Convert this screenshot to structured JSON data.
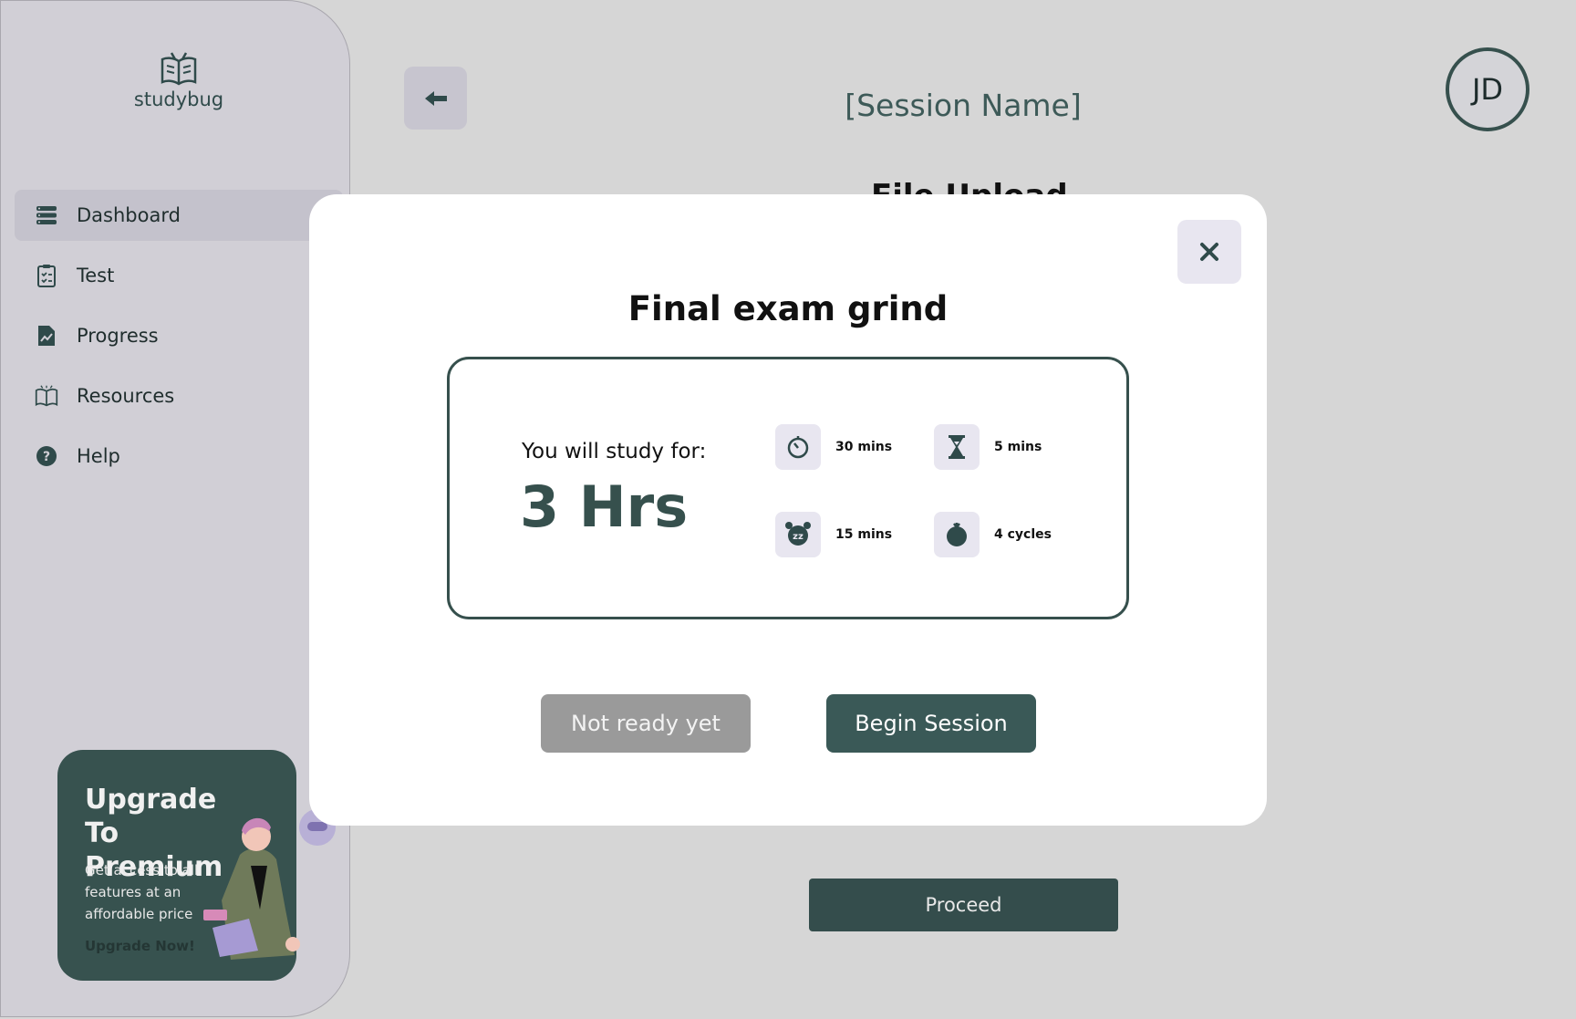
{
  "app": {
    "logo_text": "studybug"
  },
  "sidebar": {
    "items": [
      {
        "label": "Dashboard",
        "icon": "dashboard-icon",
        "active": true
      },
      {
        "label": "Test",
        "icon": "clipboard-icon"
      },
      {
        "label": "Progress",
        "icon": "progress-chart-icon"
      },
      {
        "label": "Resources",
        "icon": "book-icon"
      },
      {
        "label": "Help",
        "icon": "help-icon"
      }
    ]
  },
  "promo": {
    "title": "Upgrade To Premium",
    "description": "Get access to all features at an affordable price",
    "link": "Upgrade Now!"
  },
  "header": {
    "session_name": "[Session Name]",
    "avatar_initials": "JD",
    "behind_heading": "File Upload"
  },
  "main": {
    "proceed_label": "Proceed"
  },
  "modal": {
    "title": "Final exam grind",
    "study_label": "You will study for:",
    "study_value": "3 Hrs",
    "stats": [
      {
        "icon": "stopwatch-icon",
        "label": "30 mins"
      },
      {
        "icon": "hourglass-icon",
        "label": "5 mins"
      },
      {
        "icon": "alarm-clock-icon",
        "label": "15 mins"
      },
      {
        "icon": "tomato-icon",
        "label": "4 cycles"
      }
    ],
    "secondary_button": "Not ready yet",
    "primary_button": "Begin Session"
  },
  "colors": {
    "accent": "#36504d",
    "background": "#d6d6d6",
    "sidebar": "#d1cfd6",
    "modal": "#ffffff",
    "secondary_button": "#9a9a9a"
  }
}
